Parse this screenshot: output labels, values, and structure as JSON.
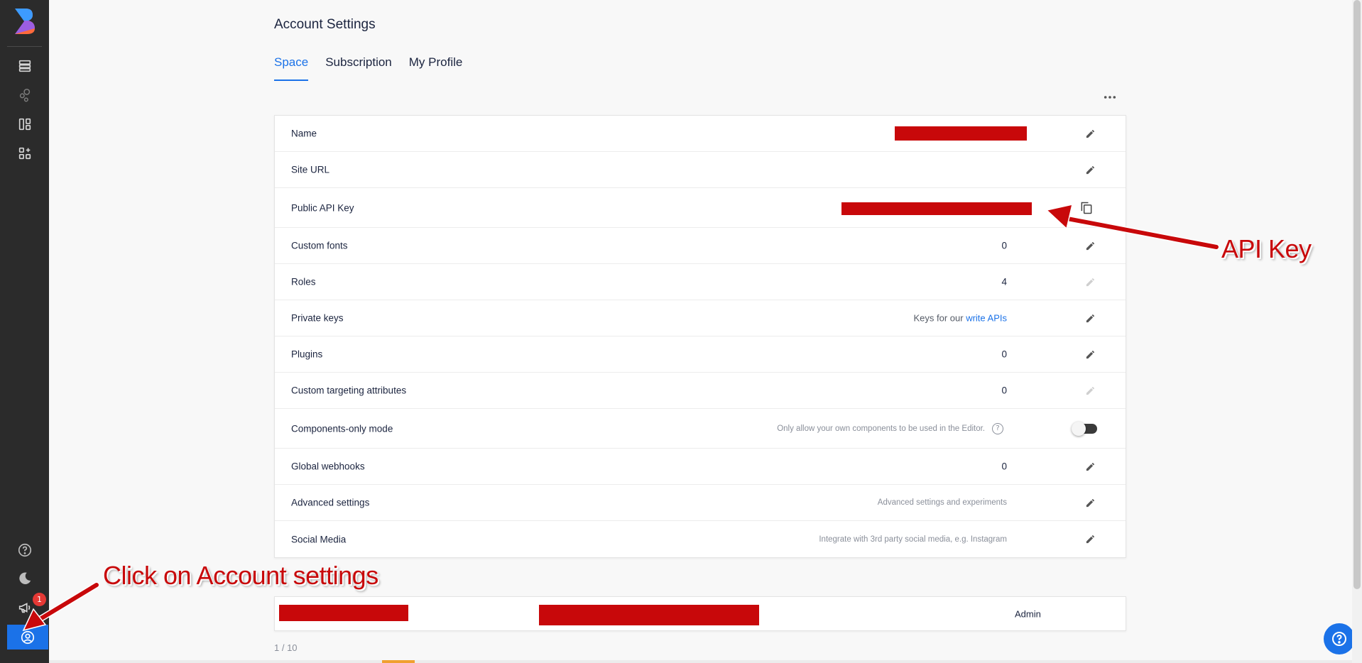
{
  "page": {
    "title": "Account Settings",
    "tabs": [
      {
        "label": "Space",
        "active": true
      },
      {
        "label": "Subscription",
        "active": false
      },
      {
        "label": "My Profile",
        "active": false
      }
    ]
  },
  "settings": {
    "rows": [
      {
        "label": "Name",
        "value": "",
        "redacted": true
      },
      {
        "label": "Site URL",
        "value": ""
      },
      {
        "label": "Public API Key",
        "value": "",
        "redacted": true
      },
      {
        "label": "Custom fonts",
        "value": "0"
      },
      {
        "label": "Roles",
        "value": "4"
      },
      {
        "label": "Private keys",
        "value_prefix": "Keys for our ",
        "value_link": "write APIs"
      },
      {
        "label": "Plugins",
        "value": "0"
      },
      {
        "label": "Custom targeting attributes",
        "value": "0"
      },
      {
        "label": "Components-only mode",
        "value": "Only allow your own components to be used in the Editor.",
        "help": "?"
      },
      {
        "label": "Global webhooks",
        "value": "0"
      },
      {
        "label": "Advanced settings",
        "value": "Advanced settings and experiments"
      },
      {
        "label": "Social Media",
        "value": "Integrate with 3rd party social media, e.g. Instagram"
      }
    ]
  },
  "members": {
    "role": "Admin",
    "pagination": "1 / 10"
  },
  "sidebar": {
    "badge_count": "1"
  },
  "annotations": {
    "api_key": "API Key",
    "account_settings": "Click on Account settings"
  },
  "colors": {
    "accent": "#1b72e8",
    "sidebar": "#2b2b2b",
    "annotation": "#c8080a"
  },
  "icons": [
    "logo-icon",
    "content-icon",
    "components-icon",
    "blocks-icon",
    "apps-icon",
    "help-icon",
    "moon-icon",
    "megaphone-icon",
    "account-icon",
    "edit-icon",
    "copy-icon",
    "more-icon"
  ]
}
